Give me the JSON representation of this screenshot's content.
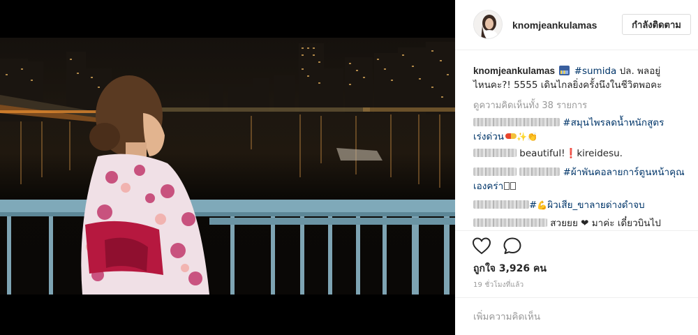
{
  "post": {
    "username": "knomjeankulamas",
    "follow_label": "กำลังติดตาม",
    "caption_user": "knomjeankulamas",
    "caption_emoji": "night-city-emoji",
    "caption_hashtag": "#sumida",
    "caption_line1_rest": " ปล. พลอยู่",
    "caption_line2": "ไหนคะ?! 5555 เดินไกลยิ่งครั้งนึงในชีวิตพอคะ",
    "view_all_comments": "ดูความคิดเห็นทั้ง 38 รายการ"
  },
  "comments": [
    {
      "text": "#สมุนไพรลดน้ำหนักสูตร",
      "text2": "เร่งด่วน",
      "icons": [
        "pill-emoji",
        "sparkles-emoji",
        "clapping-hands-emoji"
      ]
    },
    {
      "text": "beautiful!",
      "excl": "❗",
      "text2": "kireidesu."
    },
    {
      "text": "#ผ้าพันคอลายการ์ตูนหน้าคุณ",
      "text2": "เองคร่า"
    },
    {
      "text": "#",
      "text_tag": "ผิวเสีย_ขาลายด่างดำจบ",
      "icons": [
        "flexed-biceps-emoji"
      ]
    },
    {
      "text": "สวยยย ❤ มาค่ะ เดี๋ยวบินไป"
    }
  ],
  "actions": {
    "likes": "ถูกใจ 3,926 คน",
    "time": "19 ชั่วโมงที่แล้ว",
    "add_comment_placeholder": "เพิ่มความคิดเห็น"
  },
  "icons": {
    "like": "heart-outline-icon",
    "comment": "speech-bubble-icon"
  },
  "colors": {
    "hashtag": "#003569",
    "muted": "#999999",
    "text": "#262626",
    "border": "#dbdbdb"
  }
}
